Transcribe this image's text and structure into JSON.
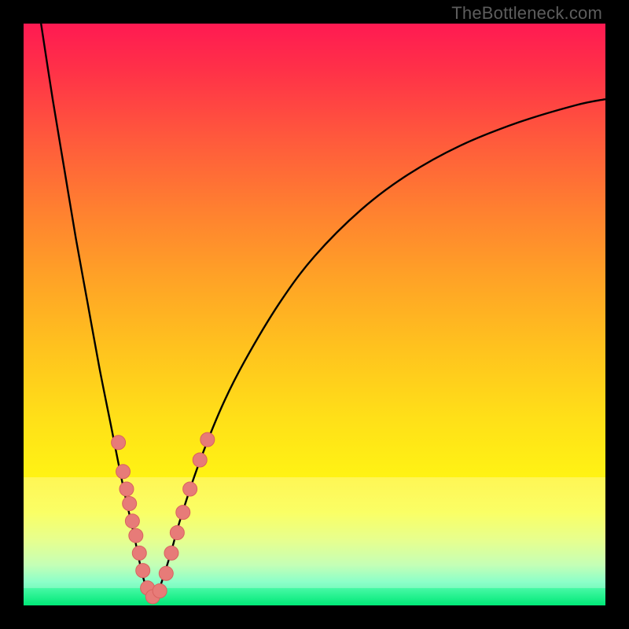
{
  "watermark": "TheBottleneck.com",
  "colors": {
    "frame": "#000000",
    "curve_stroke": "#000000",
    "marker_fill": "#e77b78",
    "marker_stroke": "#d9625f"
  },
  "chart_data": {
    "type": "line",
    "title": "",
    "xlabel": "",
    "ylabel": "",
    "xlim": [
      0,
      100
    ],
    "ylim": [
      0,
      100
    ],
    "grid": false,
    "legend": false,
    "series": [
      {
        "name": "bottleneck-curve",
        "x": [
          3,
          5,
          7,
          9,
          11,
          13,
          15,
          17,
          19,
          20.5,
          22,
          23,
          25,
          27,
          30,
          34,
          38,
          44,
          50,
          58,
          66,
          75,
          85,
          95,
          100
        ],
        "y": [
          100,
          87,
          75,
          63,
          52,
          41,
          31,
          21,
          12,
          5,
          1,
          2,
          8,
          15,
          24,
          34,
          42,
          52,
          60,
          68,
          74,
          79,
          83,
          86,
          87
        ]
      }
    ],
    "markers": [
      {
        "x": 16.3,
        "y": 28.0
      },
      {
        "x": 17.1,
        "y": 23.0
      },
      {
        "x": 17.7,
        "y": 20.0
      },
      {
        "x": 18.2,
        "y": 17.5
      },
      {
        "x": 18.7,
        "y": 14.5
      },
      {
        "x": 19.3,
        "y": 12.0
      },
      {
        "x": 19.9,
        "y": 9.0
      },
      {
        "x": 20.5,
        "y": 6.0
      },
      {
        "x": 21.3,
        "y": 3.0
      },
      {
        "x": 22.2,
        "y": 1.5
      },
      {
        "x": 23.4,
        "y": 2.5
      },
      {
        "x": 24.5,
        "y": 5.5
      },
      {
        "x": 25.4,
        "y": 9.0
      },
      {
        "x": 26.4,
        "y": 12.5
      },
      {
        "x": 27.4,
        "y": 16.0
      },
      {
        "x": 28.6,
        "y": 20.0
      },
      {
        "x": 30.3,
        "y": 25.0
      },
      {
        "x": 31.6,
        "y": 28.5
      }
    ],
    "green_bottom_fraction": 0.03,
    "pale_band": {
      "top_fraction": 0.78,
      "bottom_fraction": 0.97
    }
  }
}
